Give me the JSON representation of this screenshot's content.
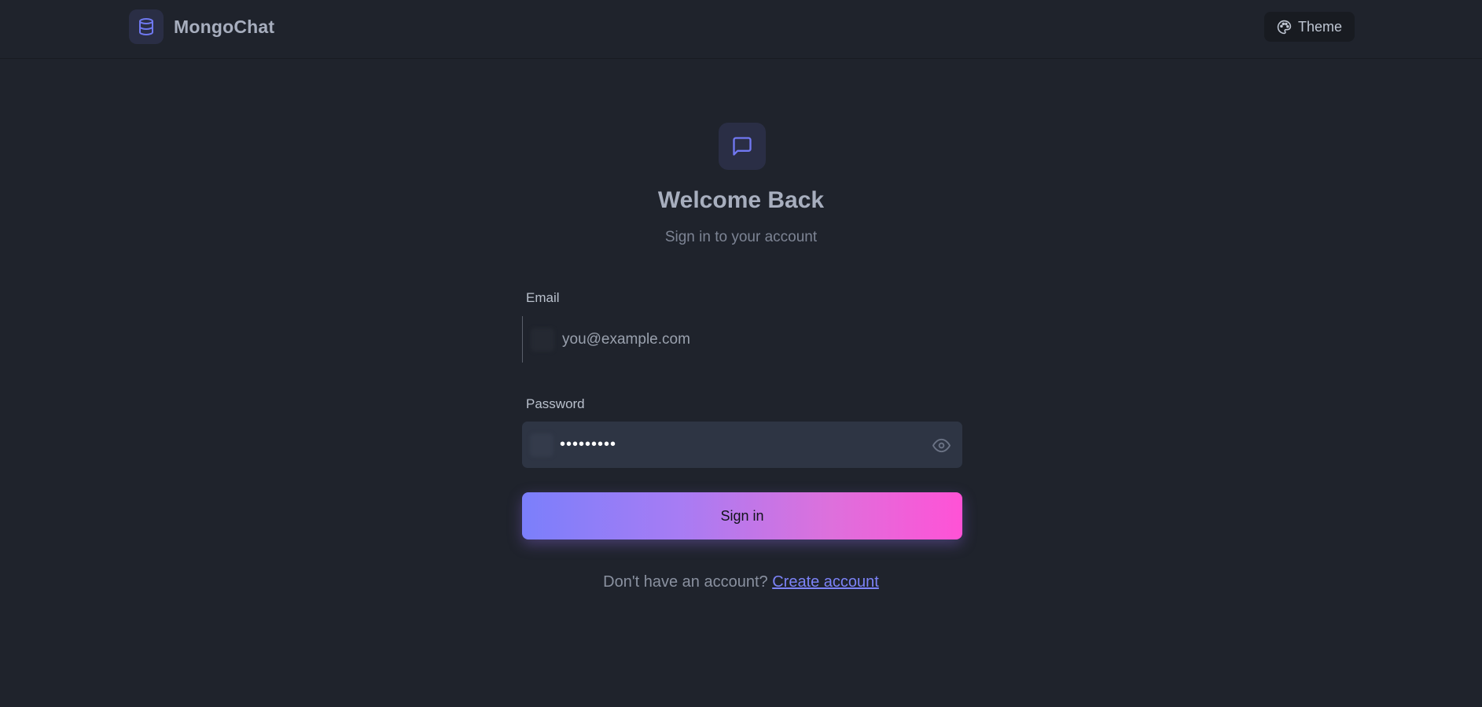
{
  "header": {
    "brand_name": "MongoChat",
    "brand_icon": "database-icon",
    "theme_label": "Theme",
    "theme_icon": "palette-icon"
  },
  "auth": {
    "hero_icon": "message-square-icon",
    "title": "Welcome Back",
    "subtitle": "Sign in to your account",
    "email_label": "Email",
    "email_placeholder": "you@example.com",
    "email_value": "",
    "password_label": "Password",
    "password_value": "•••••••••",
    "password_toggle_icon": "eye-icon",
    "submit_label": "Sign in",
    "footer_prompt": "Don't have an account?",
    "footer_link": "Create account"
  },
  "colors": {
    "background": "#1f232c",
    "accent": "#7c83f7",
    "gradient_start": "#7b7ffb",
    "gradient_end": "#ff52d6"
  }
}
